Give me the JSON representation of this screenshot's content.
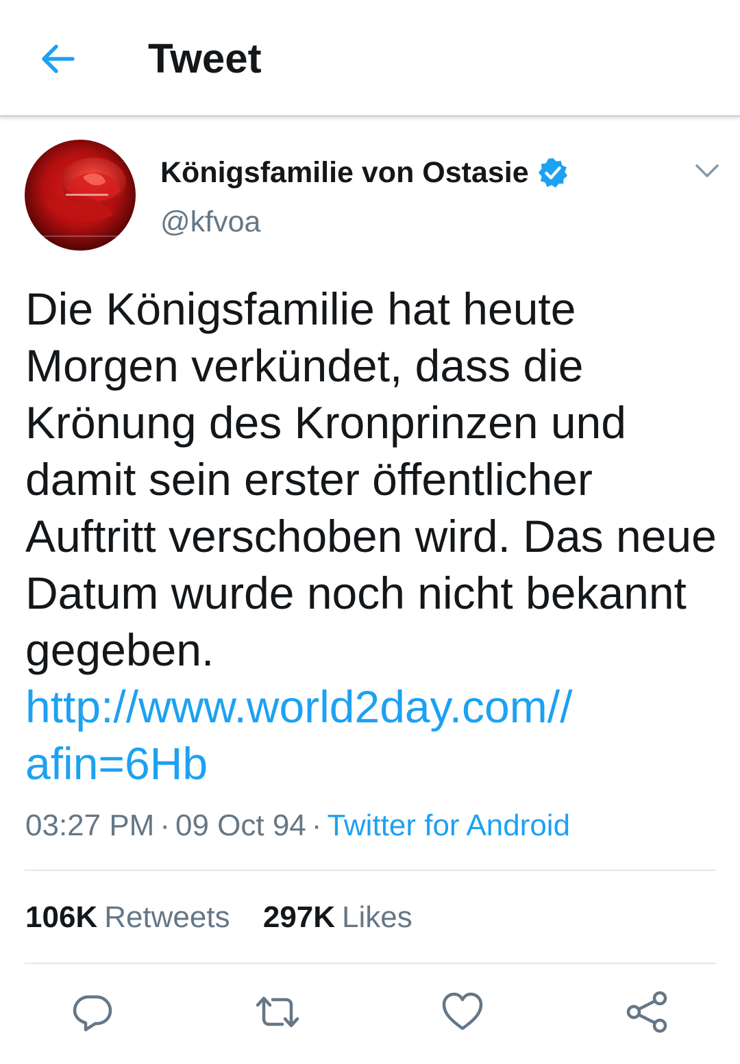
{
  "header": {
    "title": "Tweet",
    "back_icon": "arrow-left-icon",
    "accent_color": "#1da1f2"
  },
  "tweet": {
    "author": {
      "display_name": "Königsfamilie von Ostasie",
      "handle": "@kfvoa",
      "verified": true,
      "avatar_icon": "red-rose-avatar"
    },
    "menu_icon": "chevron-down-icon",
    "text": "Die Königsfamilie hat heute Morgen verkündet, dass die Krönung des Kronprinzen und damit sein erster öffentlicher Auftritt verschoben wird. Das neue Datum wurde noch nicht bekannt gegeben.",
    "link": {
      "line1": "http://www.world2day.com//",
      "line2": "afin=6Hb"
    },
    "time": "03:27 PM",
    "date": "09 Oct 94",
    "separator": "·",
    "source": "Twitter for Android"
  },
  "stats": {
    "retweets_count": "106K",
    "retweets_label": "Retweets",
    "likes_count": "297K",
    "likes_label": "Likes"
  },
  "actions": [
    {
      "name": "reply",
      "icon": "reply-icon"
    },
    {
      "name": "retweet",
      "icon": "retweet-icon"
    },
    {
      "name": "like",
      "icon": "heart-icon"
    },
    {
      "name": "share",
      "icon": "share-icon"
    }
  ],
  "colors": {
    "text_primary": "#14171a",
    "text_secondary": "#657786",
    "link": "#1da1f2",
    "divider": "#e1e8ed",
    "icon_gray": "#657786"
  }
}
